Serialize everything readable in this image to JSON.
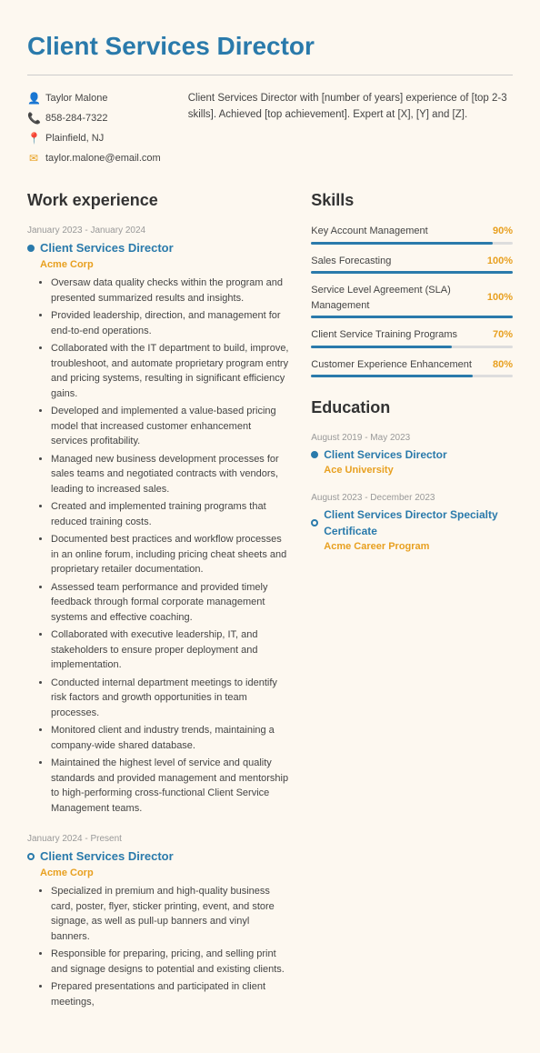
{
  "header": {
    "title": "Client Services Director"
  },
  "contact": {
    "name": "Taylor Malone",
    "phone": "858-284-7322",
    "location": "Plainfield, NJ",
    "email": "taylor.malone@email.com",
    "summary": "Client Services Director with [number of years] experience of [top 2-3 skills]. Achieved [top achievement]. Expert at [X], [Y] and [Z]."
  },
  "work_experience": {
    "section_title": "Work experience",
    "jobs": [
      {
        "date": "January 2023 - January 2024",
        "title": "Client Services Director",
        "company": "Acme Corp",
        "filled": true,
        "bullets": [
          "Oversaw data quality checks within the program and presented summarized results and insights.",
          "Provided leadership, direction, and management for end-to-end operations.",
          "Collaborated with the IT department to build, improve, troubleshoot, and automate proprietary program entry and pricing systems, resulting in significant efficiency gains.",
          "Developed and implemented a value-based pricing model that increased customer enhancement services profitability.",
          "Managed new business development processes for sales teams and negotiated contracts with vendors, leading to increased sales.",
          "Created and implemented training programs that reduced training costs.",
          "Documented best practices and workflow processes in an online forum, including pricing cheat sheets and proprietary retailer documentation.",
          "Assessed team performance and provided timely feedback through formal corporate management systems and effective coaching.",
          "Collaborated with executive leadership, IT, and stakeholders to ensure proper deployment and implementation.",
          "Conducted internal department meetings to identify risk factors and growth opportunities in team processes.",
          "Monitored client and industry trends, maintaining a company-wide shared database.",
          "Maintained the highest level of service and quality standards and provided management and mentorship to high-performing cross-functional Client Service Management teams."
        ]
      },
      {
        "date": "January 2024 - Present",
        "title": "Client Services Director",
        "company": "Acme Corp",
        "filled": false,
        "bullets": [
          "Specialized in premium and high-quality business card, poster, flyer, sticker printing, event, and store signage, as well as pull-up banners and vinyl banners.",
          "Responsible for preparing, pricing, and selling print and signage designs to potential and existing clients.",
          "Prepared presentations and participated in client meetings,"
        ]
      }
    ]
  },
  "skills": {
    "section_title": "Skills",
    "items": [
      {
        "name": "Key Account Management",
        "pct": 90,
        "label": "90%"
      },
      {
        "name": "Sales Forecasting",
        "pct": 100,
        "label": "100%"
      },
      {
        "name": "Service Level Agreement (SLA) Management",
        "pct": 100,
        "label": "100%"
      },
      {
        "name": "Client Service Training Programs",
        "pct": 70,
        "label": "70%"
      },
      {
        "name": "Customer Experience Enhancement",
        "pct": 80,
        "label": "80%"
      }
    ]
  },
  "education": {
    "section_title": "Education",
    "items": [
      {
        "date": "August 2019 - May 2023",
        "title": "Client Services Director",
        "school": "Ace University",
        "filled": true
      },
      {
        "date": "August 2023 - December 2023",
        "title": "Client Services Director Specialty Certificate",
        "school": "Acme Career Program",
        "filled": false
      }
    ]
  }
}
